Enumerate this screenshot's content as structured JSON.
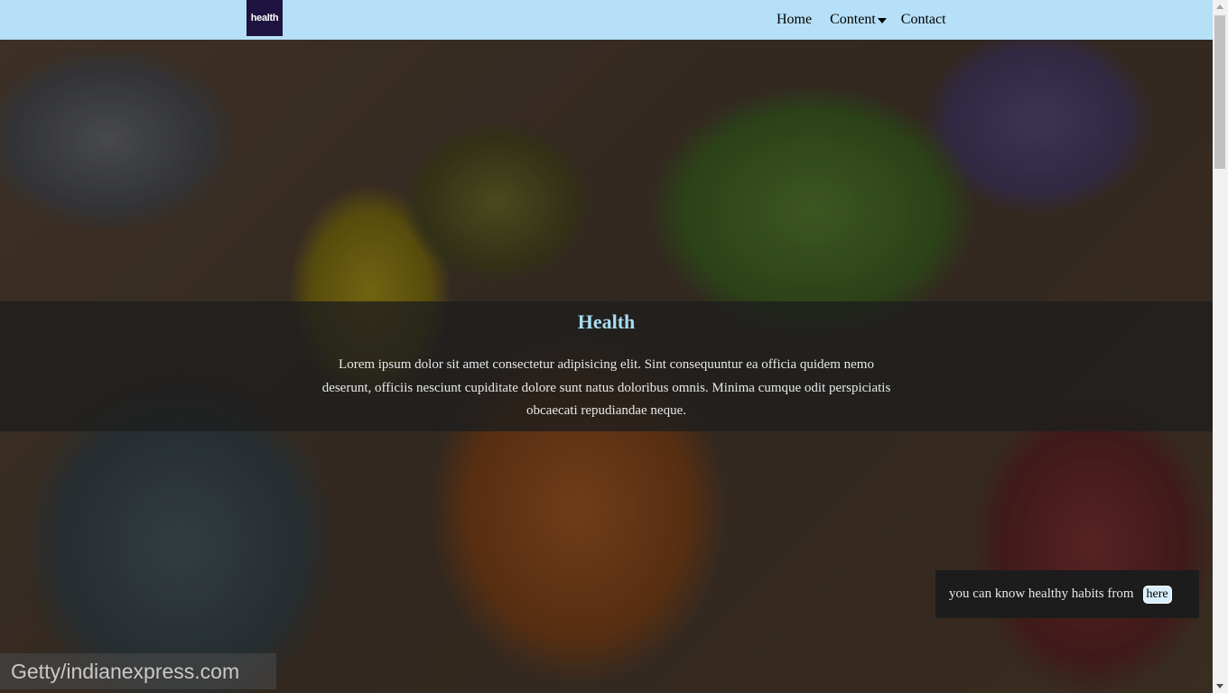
{
  "nav": {
    "logo_text": "health",
    "links": {
      "home": "Home",
      "content": "Content",
      "contact": "Contact"
    }
  },
  "hero": {
    "title": "Health",
    "description": "Lorem ipsum dolor sit amet consectetur adipisicing elit. Sint consequuntur ea officia quidem nemo deserunt, officiis nesciunt cupiditate dolore sunt natus doloribus omnis. Minima cumque odit perspiciatis obcaecati repudiandae neque.",
    "image_credit": "Getty/indianexpress.com"
  },
  "tip": {
    "text": "you can know healthy habits from",
    "link_label": "here"
  },
  "colors": {
    "nav_bg": "#b5e0f7",
    "logo_bg": "#1e1440",
    "title_color": "#a8dcf2",
    "banner_bg": "rgba(30,30,30,0.78)"
  }
}
